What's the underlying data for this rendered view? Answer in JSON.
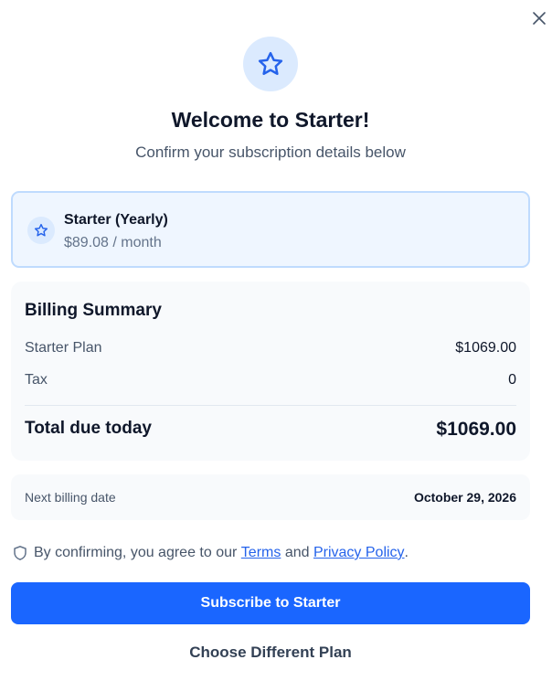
{
  "dialog": {
    "close_icon": "close-icon",
    "hero_icon": "star-icon",
    "title": "Welcome to Starter!",
    "subtitle": "Confirm your subscription details below"
  },
  "plan": {
    "icon": "star-icon",
    "name": "Starter (Yearly)",
    "price": "$89.08 / month"
  },
  "billing_summary": {
    "title": "Billing Summary",
    "rows": [
      {
        "label": "Starter Plan",
        "value": "$1069.00"
      },
      {
        "label": "Tax",
        "value": "0"
      }
    ],
    "total_label": "Total due today",
    "total_value": "$1069.00"
  },
  "next_billing": {
    "label": "Next billing date",
    "value": "October 29, 2026"
  },
  "consent": {
    "icon": "shield-icon",
    "prefix": "By confirming, you agree to our",
    "terms_link": "Terms",
    "and_text": "and",
    "privacy_link": "Privacy Policy",
    "suffix": "."
  },
  "actions": {
    "subscribe_label": "Subscribe to Starter",
    "change_plan_label": "Choose Different Plan"
  },
  "colors": {
    "accent": "#1a66ff",
    "icon_bg": "#dbeafe",
    "card_border": "#bfdbfe",
    "link": "#2563eb"
  }
}
